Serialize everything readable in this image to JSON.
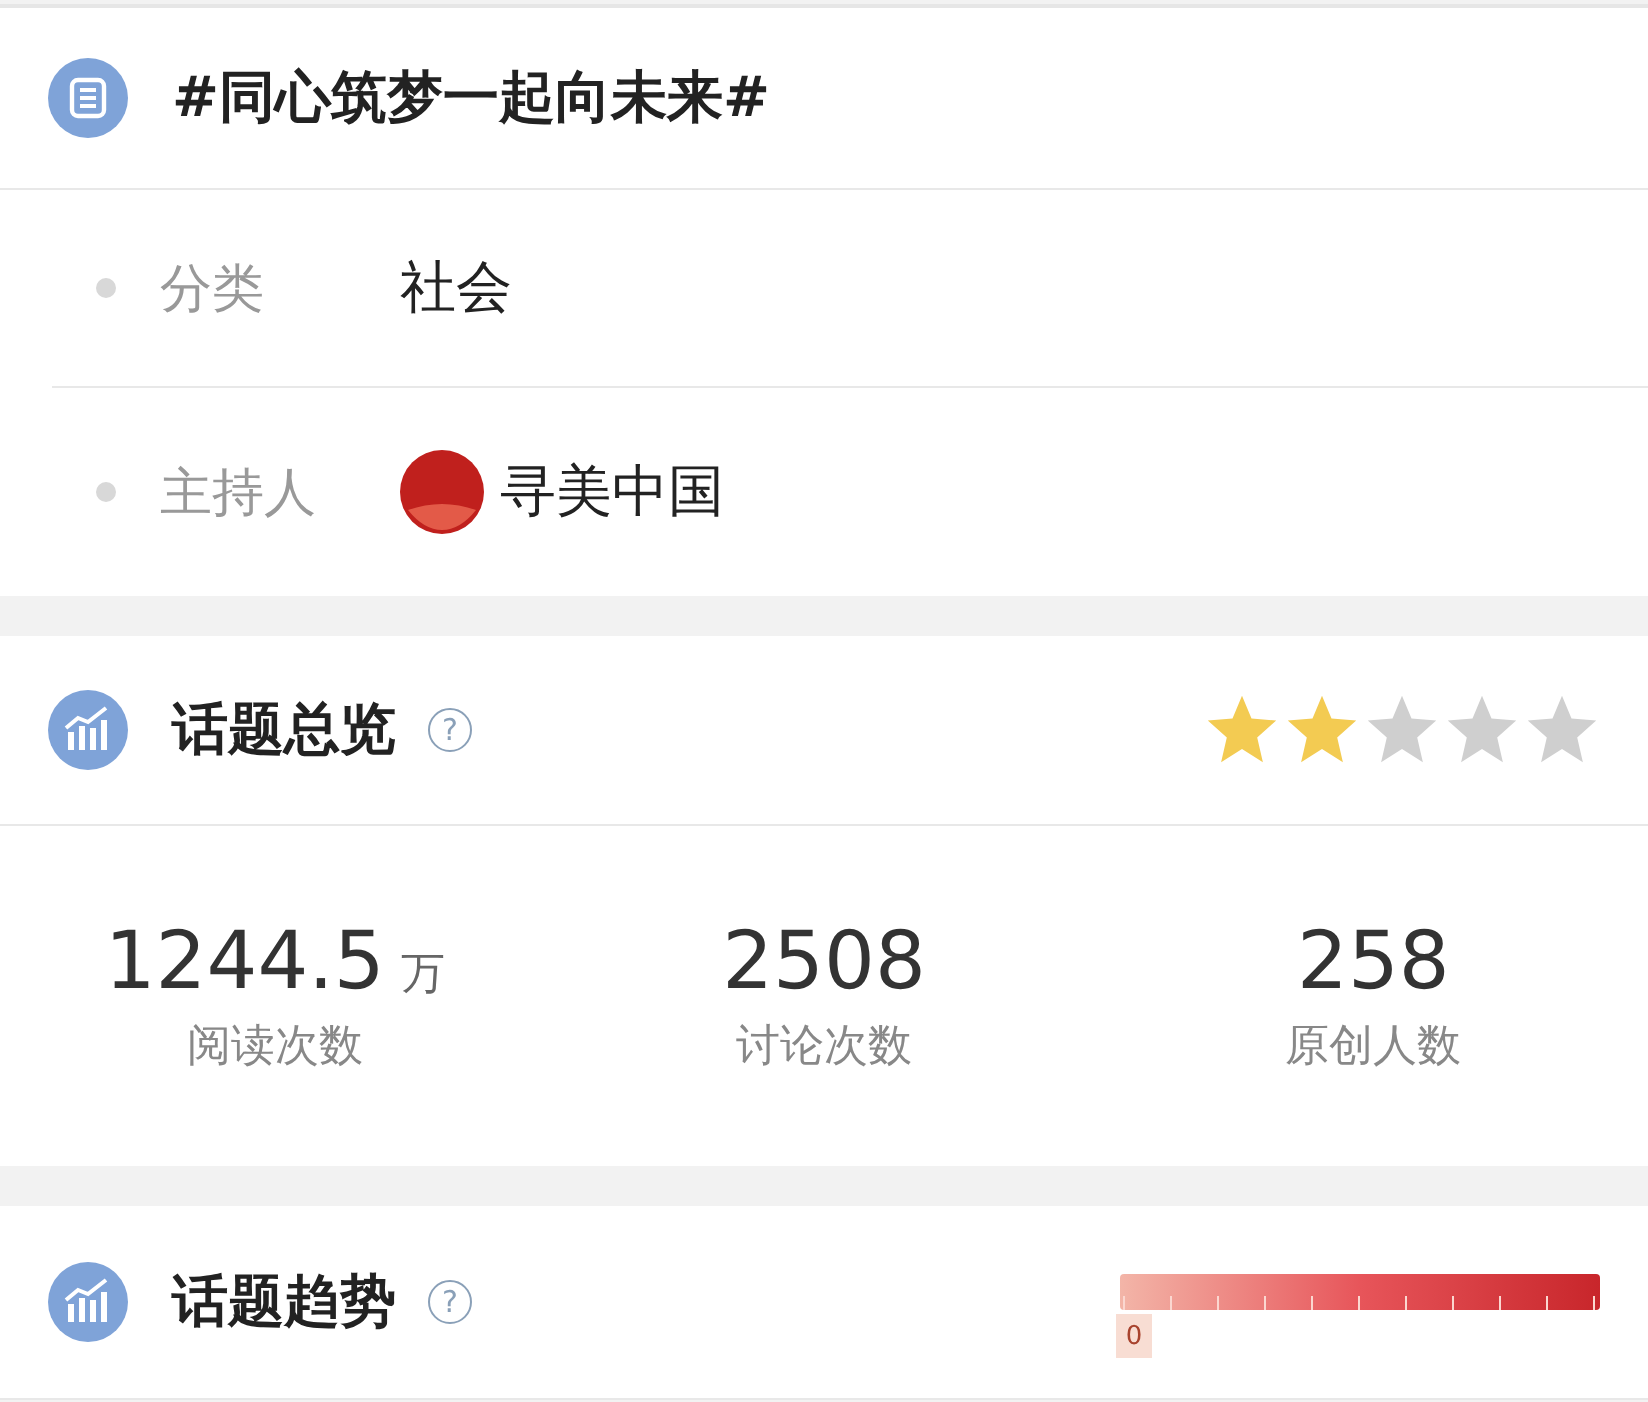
{
  "topic": {
    "title": "#同心筑梦一起向未来#"
  },
  "info": [
    {
      "label": "分类",
      "value": "社会",
      "kind": "text"
    },
    {
      "label": "主持人",
      "value": "寻美中国",
      "kind": "avatar"
    }
  ],
  "overview": {
    "title": "话题总览",
    "help": "?",
    "stars": 2,
    "stats": [
      {
        "value": "1244.5",
        "unit": "万",
        "label": "阅读次数"
      },
      {
        "value": "2508",
        "label": "讨论次数"
      },
      {
        "value": "258",
        "label": "原创人数"
      }
    ]
  },
  "trend": {
    "title": "话题趋势",
    "help": "?",
    "marker": "0"
  }
}
